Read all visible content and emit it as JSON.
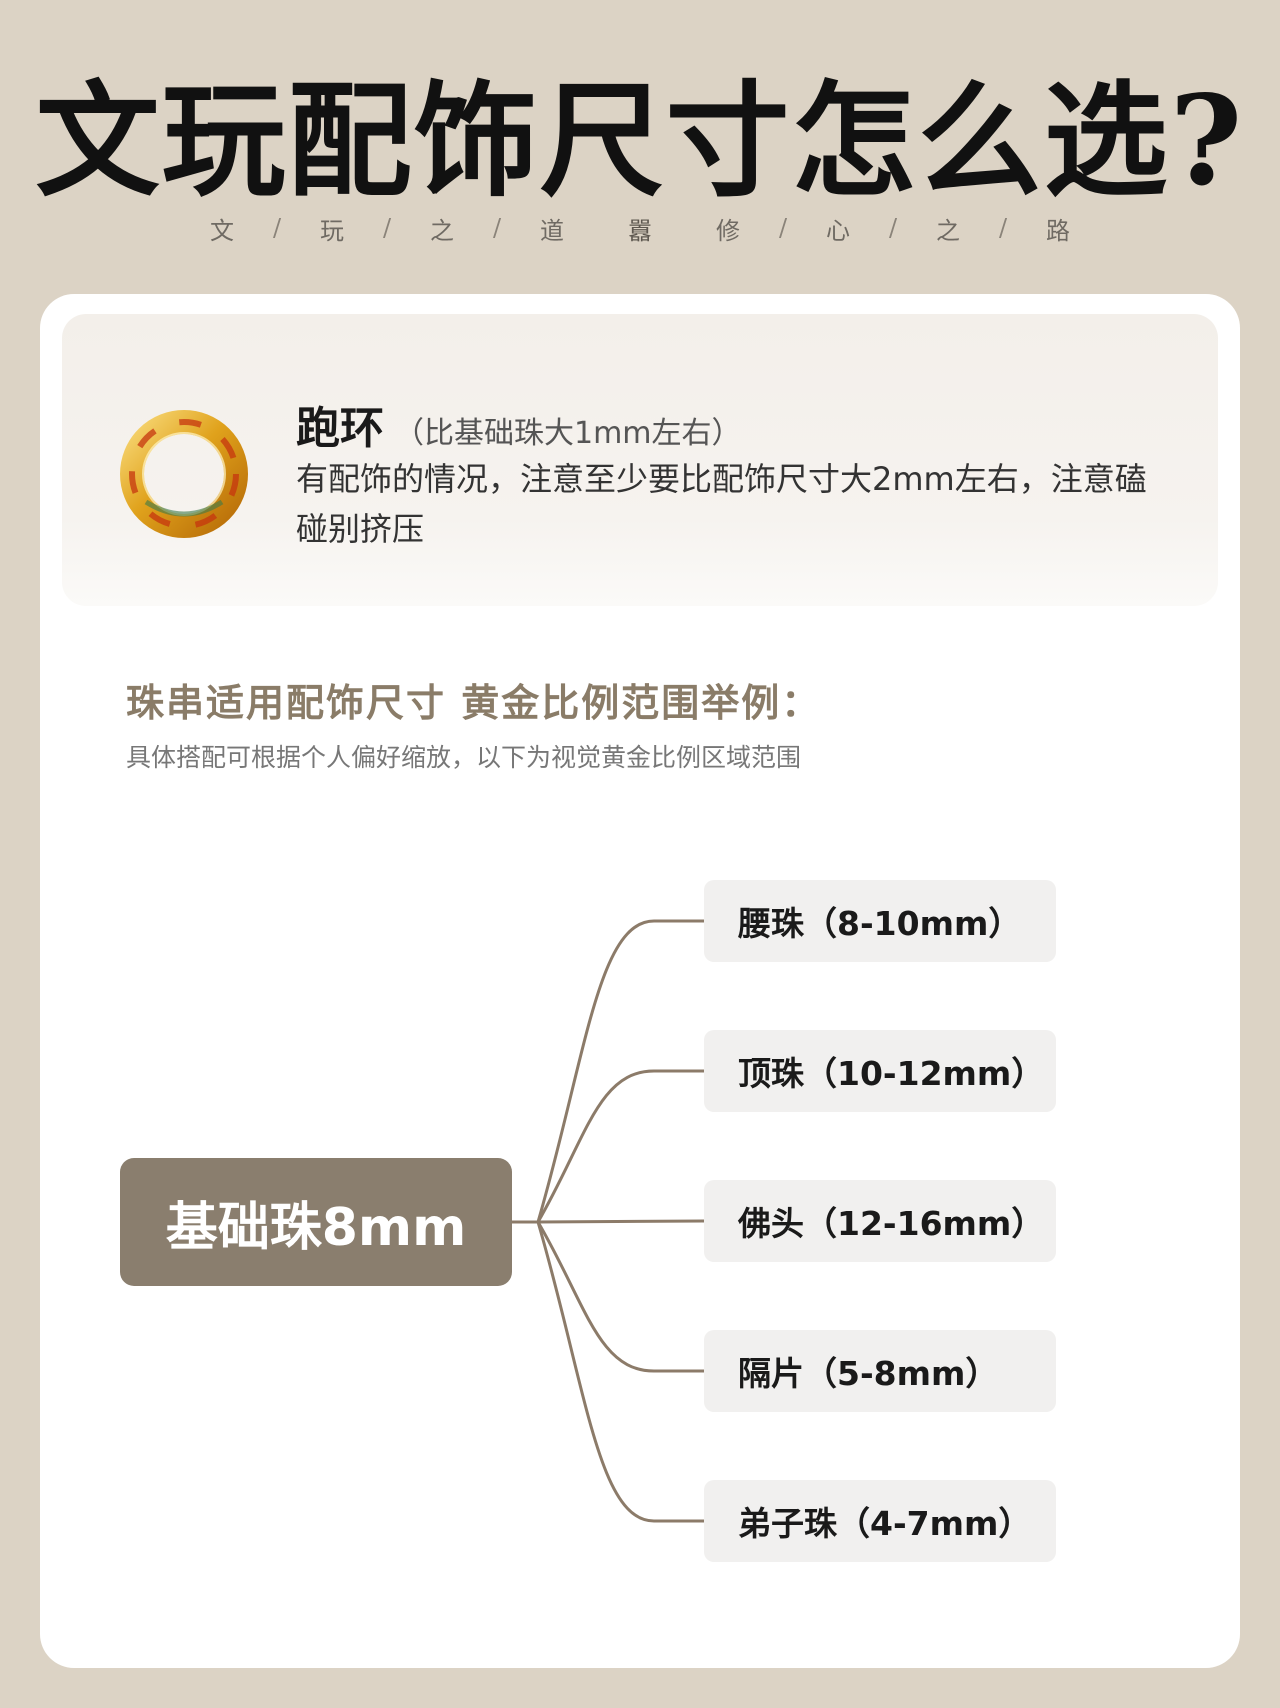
{
  "header": {
    "title": "文玩配饰尺寸怎么选?",
    "motto_left": [
      "文",
      "玩",
      "之",
      "道"
    ],
    "motto_right": [
      "修",
      "心",
      "之",
      "路"
    ],
    "separator": "/",
    "motto_mark": "囂"
  },
  "ring_section": {
    "title": "跑环",
    "subtitle": "（比基础珠大1mm左右）",
    "description": "有配饰的情况，注意至少要比配饰尺寸大2mm左右，注意磕碰别挤压",
    "icon": "gold-ring-icon"
  },
  "guide": {
    "title": "珠串适用配饰尺寸 黄金比例范围举例：",
    "subtitle": "具体搭配可根据个人偏好缩放，以下为视觉黄金比例区域范围"
  },
  "mindmap": {
    "root": "基础珠8mm",
    "branches": [
      "腰珠（8-10mm）",
      "顶珠（10-12mm）",
      "佛头（12-16mm）",
      "隔片（5-8mm）",
      "弟子珠（4-7mm）"
    ]
  },
  "colors": {
    "background": "#dcd3c5",
    "card": "#ffffff",
    "accent": "#8a7e6e",
    "connector": "#8c7b69",
    "leaf": "#f1f0ef"
  }
}
